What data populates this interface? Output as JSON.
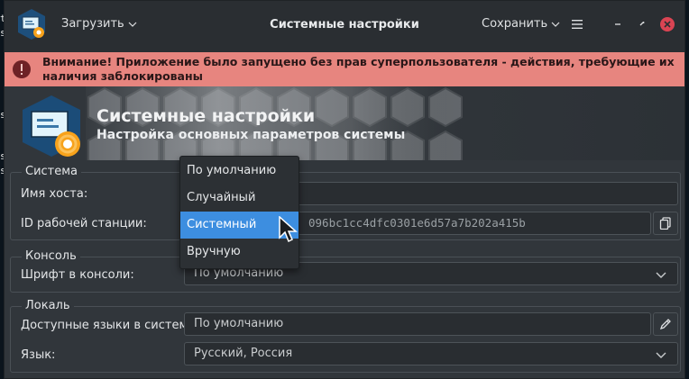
{
  "desktop_left_chars": [
    "t",
    "s",
    "s",
    "s",
    "s"
  ],
  "titlebar": {
    "load_label": "Загрузить",
    "title": "Системные настройки",
    "save_label": "Сохранить"
  },
  "warning": {
    "text": "Внимание! Приложение было запущено без прав суперпользователя - действия, требующие их наличия заблокированы"
  },
  "banner": {
    "title": "Системные настройки",
    "subtitle": "Настройка основных параметров системы"
  },
  "system_group": {
    "title": "Система",
    "hostname_label": "Имя хоста:",
    "hostname_value": "",
    "machine_id_label": "ID рабочей станции:",
    "machine_id_value": "096bc1cc4dfc0301e6d57a7b202a415b"
  },
  "console_group": {
    "title": "Консоль",
    "font_label": "Шрифт в консоли:",
    "font_value": "По умолчанию"
  },
  "locale_group": {
    "title": "Локаль",
    "languages_label": "Доступные языки в системе:",
    "languages_value": "По умолчанию",
    "language_label": "Язык:",
    "language_value": "Русский, Россия"
  },
  "popup_menu": {
    "items": [
      "По умолчанию",
      "Случайный",
      "Системный",
      "Вручную"
    ],
    "selected_index": 2
  },
  "colors": {
    "accent": "#3d8ee0",
    "warning_bg": "#e7857f",
    "close": "#da4453"
  }
}
